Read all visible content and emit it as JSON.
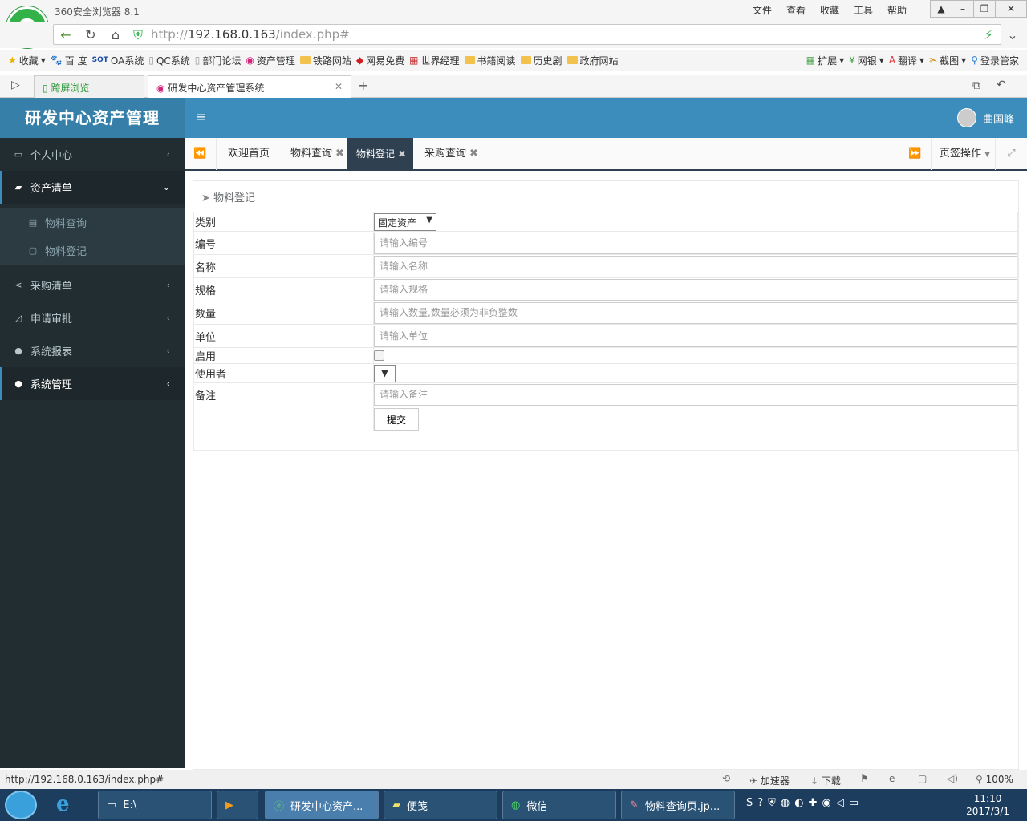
{
  "browser": {
    "app_title": "360安全浏览器 8.1",
    "menu": [
      "文件",
      "查看",
      "收藏",
      "工具",
      "帮助"
    ],
    "url_prefix": "http://",
    "url_host": "192.168.0.163",
    "url_path": "/index.php#",
    "bookmarks": [
      "收藏",
      "百 度",
      "OA系统",
      "QC系统",
      "部门论坛",
      "资产管理",
      "铁路网站",
      "网易免费",
      "世界经理",
      "书籍阅读",
      "历史剧",
      "政府网站"
    ],
    "bookmarks_right": [
      "扩展",
      "网银",
      "翻译",
      "截图",
      "登录管家"
    ],
    "tabs": [
      "跨屏浏览",
      "研发中心资产管理系统"
    ],
    "status_url": "http://192.168.0.163/index.php#",
    "status_items": [
      "加速器",
      "下载",
      "100%"
    ]
  },
  "app": {
    "brand": "研发中心资产管理",
    "user_name": "曲国峰",
    "sidebar": [
      {
        "label": "个人中心"
      },
      {
        "label": "资产清单"
      },
      {
        "label": "物料查询"
      },
      {
        "label": "物料登记"
      },
      {
        "label": "采购清单"
      },
      {
        "label": "申请审批"
      },
      {
        "label": "系统报表"
      },
      {
        "label": "系统管理"
      }
    ],
    "content_tabs": [
      "欢迎首页",
      "物料查询",
      "物料登记",
      "采购查询"
    ],
    "tab_ops": "页签操作",
    "panel_title": "物料登记",
    "form": {
      "category_label": "类别",
      "category_value": "固定资产",
      "code_label": "编号",
      "code_placeholder": "请输入编号",
      "name_label": "名称",
      "name_placeholder": "请输入名称",
      "spec_label": "规格",
      "spec_placeholder": "请输入规格",
      "qty_label": "数量",
      "qty_placeholder": "请输入数量,数量必须为非负整数",
      "unit_label": "单位",
      "unit_placeholder": "请输入单位",
      "enable_label": "启用",
      "user_label": "使用者",
      "note_label": "备注",
      "note_placeholder": "请输入备注",
      "submit_label": "提交"
    }
  },
  "taskbar": {
    "items": [
      "E:\\",
      "研发中心资产...",
      "便笺",
      "微信",
      "物料查询页.jp..."
    ],
    "time": "11:10",
    "date": "2017/3/1"
  }
}
